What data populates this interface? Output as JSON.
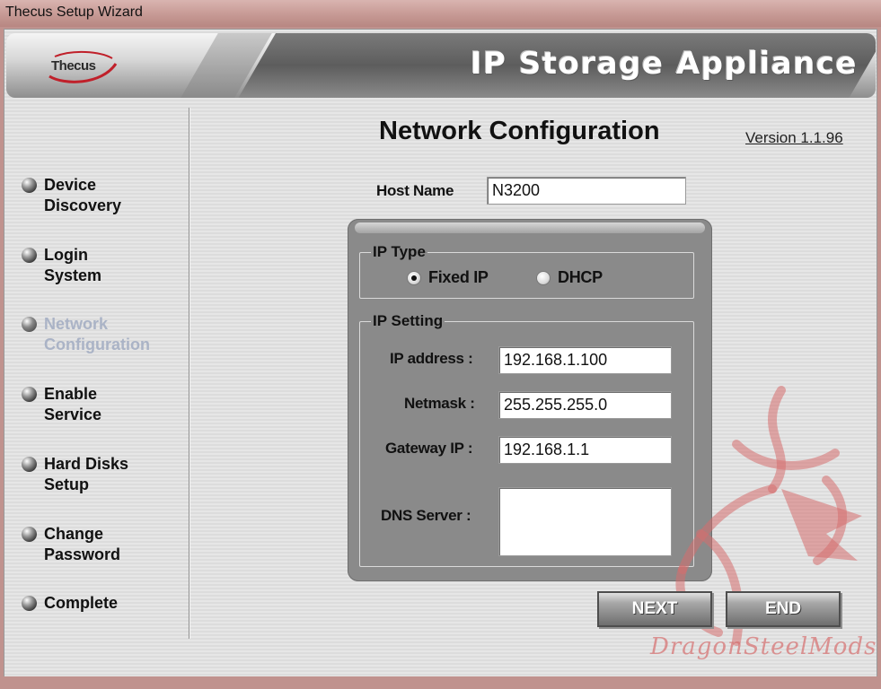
{
  "window": {
    "title": "Thecus Setup Wizard"
  },
  "banner": {
    "logo": "Thecus",
    "title": "IP Storage Appliance"
  },
  "sidebar": {
    "items": [
      {
        "line1": "Device",
        "line2": "Discovery"
      },
      {
        "line1": "Login",
        "line2": "System"
      },
      {
        "line1": "Network",
        "line2": "Configuration",
        "active": true
      },
      {
        "line1": "Enable",
        "line2": "Service"
      },
      {
        "line1": "Hard Disks",
        "line2": "Setup"
      },
      {
        "line1": "Change",
        "line2": "Password"
      },
      {
        "line1": "Complete",
        "line2": ""
      }
    ]
  },
  "main": {
    "heading": "Network Configuration",
    "version": "Version 1.1.96",
    "host_name_label": "Host Name",
    "host_name_value": "N3200",
    "ip_type": {
      "legend": "IP Type",
      "fixed_label": "Fixed IP",
      "dhcp_label": "DHCP",
      "selected": "Fixed IP"
    },
    "ip_setting": {
      "legend": "IP Setting",
      "ip_label": "IP address :",
      "ip_value": "192.168.1.100",
      "netmask_label": "Netmask :",
      "netmask_value": "255.255.255.0",
      "gateway_label": "Gateway IP :",
      "gateway_value": "192.168.1.1",
      "dns_label": "DNS Server :",
      "dns_value": ""
    }
  },
  "buttons": {
    "next": "NEXT",
    "end": "END"
  },
  "watermark": {
    "text": "DragonSteelMods"
  },
  "colors": {
    "active_nav": "#aab3c6",
    "panel": "#8a8a8a",
    "watermark": "#d66e6e"
  }
}
